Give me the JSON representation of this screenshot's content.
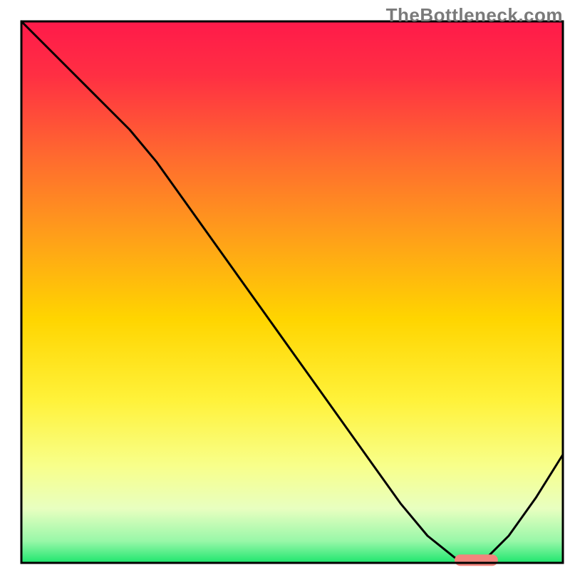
{
  "watermark": "TheBottleneck.com",
  "chart_data": {
    "type": "line",
    "title": "",
    "xlabel": "",
    "ylabel": "",
    "xlim": [
      0,
      100
    ],
    "ylim": [
      0,
      100
    ],
    "x": [
      0,
      5,
      10,
      15,
      20,
      25,
      30,
      35,
      40,
      45,
      50,
      55,
      60,
      65,
      70,
      75,
      80,
      82,
      85,
      90,
      95,
      100
    ],
    "values": [
      100,
      95,
      90,
      85,
      80,
      74,
      67,
      60,
      53,
      46,
      39,
      32,
      25,
      18,
      11,
      5,
      1,
      0,
      0,
      5,
      12,
      20
    ],
    "marker_region": {
      "x_start": 80,
      "x_end": 88,
      "y": 0.5
    },
    "gradient_stops": [
      {
        "offset": 0.0,
        "color": "#ff1a4a"
      },
      {
        "offset": 0.1,
        "color": "#ff2f43"
      },
      {
        "offset": 0.25,
        "color": "#ff6a2f"
      },
      {
        "offset": 0.4,
        "color": "#ffa019"
      },
      {
        "offset": 0.55,
        "color": "#ffd500"
      },
      {
        "offset": 0.7,
        "color": "#fff23a"
      },
      {
        "offset": 0.82,
        "color": "#f8ff8a"
      },
      {
        "offset": 0.9,
        "color": "#e8ffc0"
      },
      {
        "offset": 0.96,
        "color": "#98f7a8"
      },
      {
        "offset": 1.0,
        "color": "#1ee66e"
      }
    ],
    "marker_color": "#f2857d",
    "curve_color": "#000000",
    "border_color": "#000000"
  }
}
